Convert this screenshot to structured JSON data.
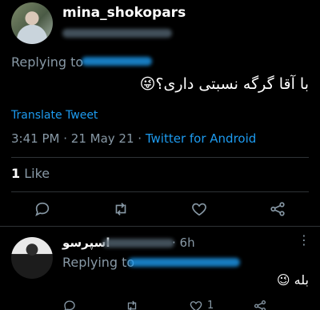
{
  "tweet": {
    "username": "mina_shokopars",
    "replying_to_label": "Replying to",
    "text": "با آقا گرگه نسبتی داری؟😜",
    "translate_label": "Translate Tweet",
    "time": "3:41 PM",
    "date": "21 May 21",
    "source": "Twitter for Android",
    "like_count": "1",
    "like_label": "Like"
  },
  "actions": [
    {
      "icon": "reply-icon"
    },
    {
      "icon": "retweet-icon"
    },
    {
      "icon": "like-icon"
    },
    {
      "icon": "share-icon"
    }
  ],
  "reply": {
    "name": "اسپرسو",
    "time": "· 6h",
    "more_label": "⋮",
    "replying_to_label": "Replying to",
    "text": "بله 😉",
    "like_count": "1"
  },
  "colors": {
    "background": "#000000",
    "accent": "#1d9bf0",
    "muted": "#8899a6",
    "divider": "#2f3336"
  }
}
